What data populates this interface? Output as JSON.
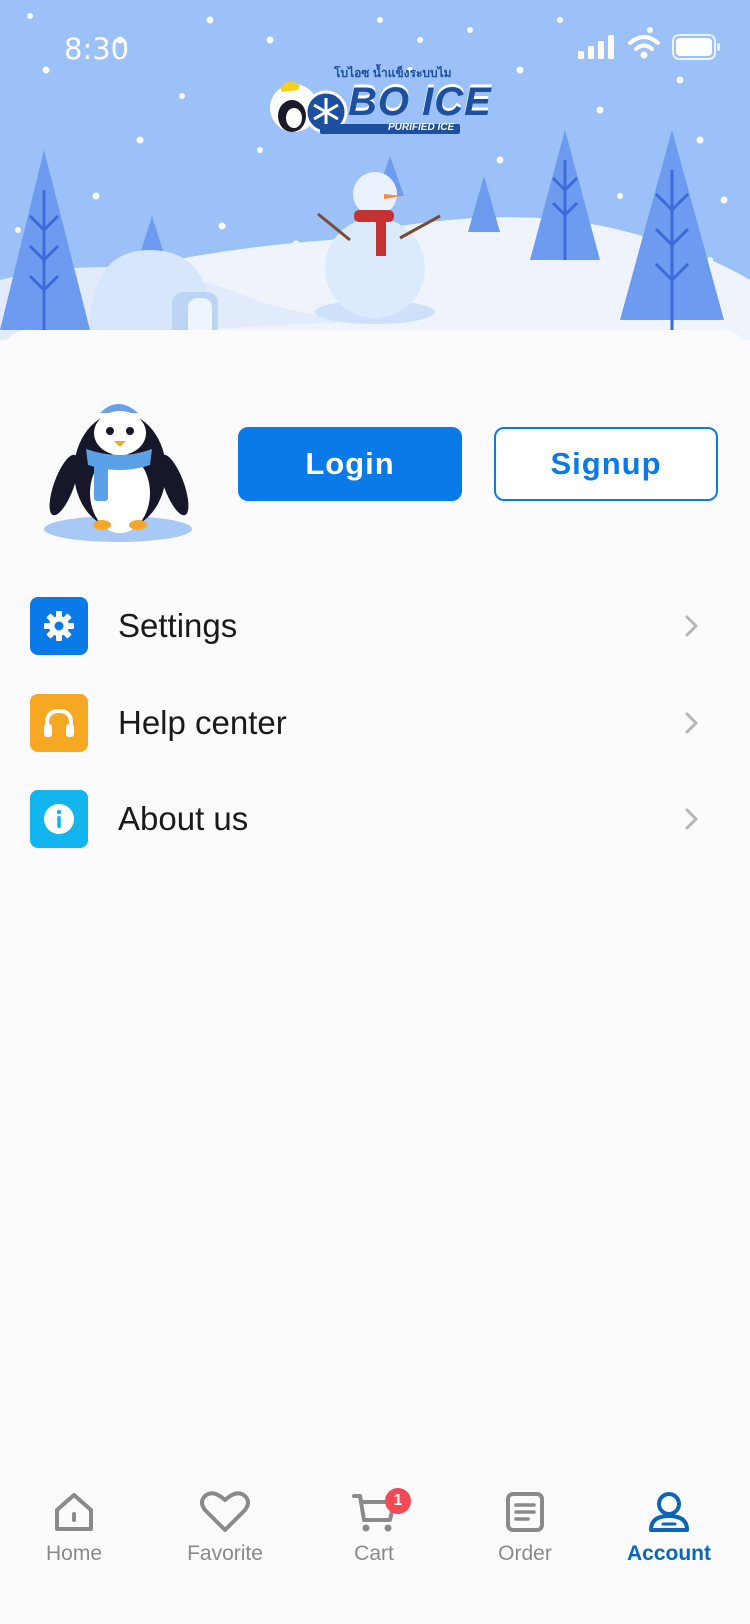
{
  "status_bar": {
    "time": "8:30"
  },
  "brand": {
    "thai_text": "โบไอซ  น้ำแข็งระบบไม",
    "name": "BO ICE",
    "tagline": "PURIFIED ICE"
  },
  "auth": {
    "login_label": "Login",
    "signup_label": "Signup"
  },
  "menu": [
    {
      "label": "Settings",
      "icon": "gear-icon",
      "color": "#0a7ae8"
    },
    {
      "label": "Help center",
      "icon": "headphones-icon",
      "color": "#f7a823"
    },
    {
      "label": "About us",
      "icon": "info-icon",
      "color": "#12b5ee"
    }
  ],
  "tabbar": {
    "items": [
      {
        "label": "Home",
        "icon": "home-icon"
      },
      {
        "label": "Favorite",
        "icon": "heart-icon"
      },
      {
        "label": "Cart",
        "icon": "cart-icon",
        "badge": "1"
      },
      {
        "label": "Order",
        "icon": "order-list-icon"
      },
      {
        "label": "Account",
        "icon": "user-icon",
        "active": true
      }
    ]
  },
  "colors": {
    "primary": "#0a7ae8",
    "header_sky": "#9dc0f7",
    "active_tab": "#0a66b8",
    "badge": "#f24a55"
  }
}
